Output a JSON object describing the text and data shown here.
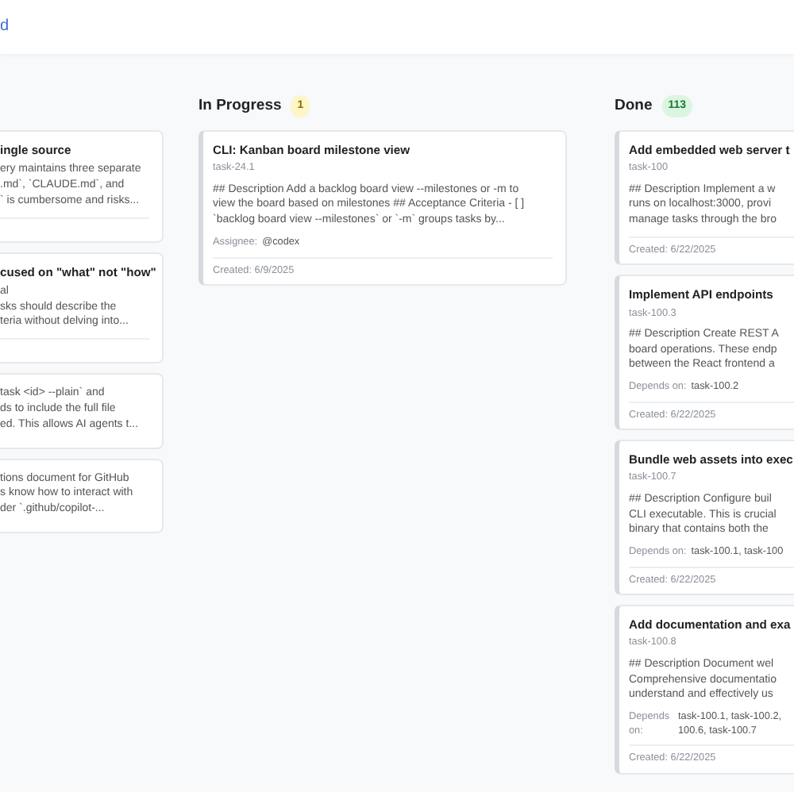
{
  "header_link": "d",
  "columns": [
    {
      "cards": [
        {
          "title": "ingle source",
          "description_lines": [
            "ery maintains three separate",
            ".md`, `CLAUDE.md`, and",
            "` is cumbersome and risks..."
          ],
          "footer_divider": true
        },
        {
          "title": "cused on \"what\" not \"how\"",
          "description_lines": [
            "al",
            "sks should describe the",
            "teria without delving into..."
          ],
          "footer_divider": true
        },
        {
          "description_lines": [
            "task <id> --plain` and",
            "ds to include the full file",
            "ed. This allows AI agents t..."
          ],
          "footer_divider": false
        },
        {
          "description_lines": [
            "tions document for GitHub",
            "s know how to interact with",
            "der `.github/copilot-..."
          ],
          "footer_divider": false
        }
      ]
    },
    {
      "title": "In Progress",
      "count": "1",
      "color": "#fdf6c6",
      "cards": [
        {
          "title": "CLI: Kanban board milestone view",
          "task_id": "task-24.1",
          "description_lines": [
            "## Description Add a backlog board view --milestones or -m to",
            "view the board based on milestones ## Acceptance Criteria - [ ]",
            "`backlog board view --milestones` or `-m` groups tasks by..."
          ],
          "assignee_label": "Assignee:",
          "assignee": "@codex",
          "created": "Created: 6/9/2025",
          "footer_divider": true
        }
      ]
    },
    {
      "title": "Done",
      "count": "113",
      "color": "#dcf5e0",
      "cards": [
        {
          "title": "Add embedded web server t",
          "task_id": "task-100",
          "description_lines": [
            "## Description Implement a w",
            "runs on localhost:3000, provi",
            "manage tasks through the bro"
          ],
          "created": "Created: 6/22/2025",
          "footer_divider": true
        },
        {
          "title": "Implement API endpoints",
          "task_id": "task-100.3",
          "description_lines": [
            "## Description Create REST A",
            "board operations. These endp",
            "between the React frontend a"
          ],
          "depends_label": "Depends on:",
          "depends_on": "task-100.2",
          "created": "Created: 6/22/2025",
          "footer_divider": true
        },
        {
          "title": "Bundle web assets into exec",
          "task_id": "task-100.7",
          "description_lines": [
            "## Description Configure buil",
            "CLI executable. This is crucial",
            "binary that contains both the"
          ],
          "depends_label": "Depends on:",
          "depends_on": "task-100.1, task-100",
          "created": "Created: 6/22/2025",
          "footer_divider": true
        },
        {
          "title": "Add documentation and exa",
          "task_id": "task-100.8",
          "description_lines": [
            "## Description Document wel",
            "Comprehensive documentatio",
            "understand and effectively us"
          ],
          "depends_label": "Depends on:",
          "depends_on": "task-100.1, task-100.2, 100.6, task-100.7",
          "created": "Created: 6/22/2025",
          "footer_divider": true
        }
      ]
    }
  ]
}
